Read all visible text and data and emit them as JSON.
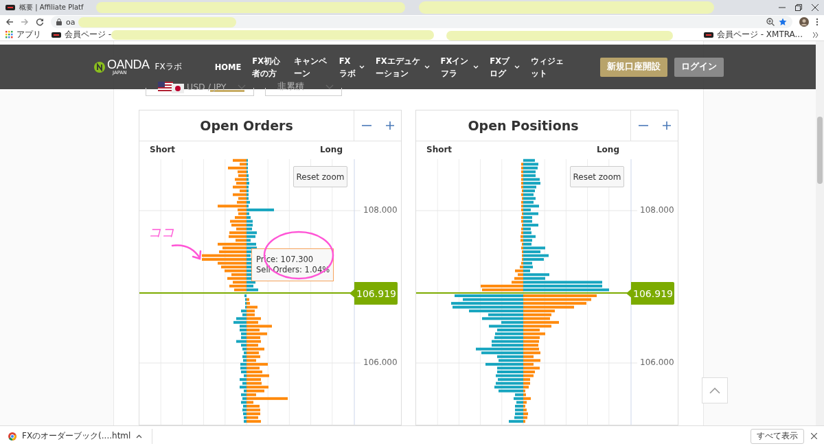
{
  "browser": {
    "tab_title": "概要 | Affiliate Platf",
    "address": "oa",
    "bookmarks": [
      {
        "label": "アプリ",
        "kind": "apps"
      },
      {
        "label": "会員ページ -",
        "kind": "site"
      },
      {
        "label": "会員ページ - XMTRA...",
        "kind": "site"
      }
    ]
  },
  "site_header": {
    "brand": "OANDA",
    "brand_sub": "JAPAN",
    "site_name": "FXラボ",
    "nav": [
      {
        "label": "HOME",
        "dropdown": false,
        "selected": true
      },
      {
        "label": "FX初心者の方",
        "dropdown": false,
        "selected": false
      },
      {
        "label": "キャンペーン",
        "dropdown": false,
        "selected": false
      },
      {
        "label": "FXラボ",
        "dropdown": true,
        "selected": false
      },
      {
        "label": "FXエデュケーション",
        "dropdown": true,
        "selected": false
      },
      {
        "label": "FXインフラ",
        "dropdown": true,
        "selected": false
      },
      {
        "label": "FXブログ",
        "dropdown": true,
        "selected": false
      },
      {
        "label": "ウィジェット",
        "dropdown": false,
        "selected": false
      }
    ],
    "buttons": [
      {
        "label": "新規口座開設",
        "kind": "primary"
      },
      {
        "label": "ログイン",
        "kind": "secondary"
      }
    ]
  },
  "selectors": [
    {
      "value": "USD / JPY",
      "kind": "currency"
    },
    {
      "value": "非累積",
      "kind": "plain"
    }
  ],
  "charts": [
    {
      "kind": "orders",
      "title": "Open Orders",
      "short_label": "Short",
      "long_label": "Long",
      "reset_label": "Reset zoom",
      "axis_labels": [
        "108.000",
        "106.000"
      ],
      "current_price": "106.919",
      "tooltip": [
        "Price: 107.300",
        "Sell Orders: 1.04%"
      ],
      "annotation": "ココ"
    },
    {
      "kind": "positions",
      "title": "Open Positions",
      "short_label": "Short",
      "long_label": "Long",
      "reset_label": "Reset zoom",
      "axis_labels": [
        "108.000",
        "106.000"
      ],
      "current_price": "106.919"
    }
  ],
  "downloads": {
    "file": "FXのオーダーブック(....html",
    "show_all": "すべて表示"
  }
}
